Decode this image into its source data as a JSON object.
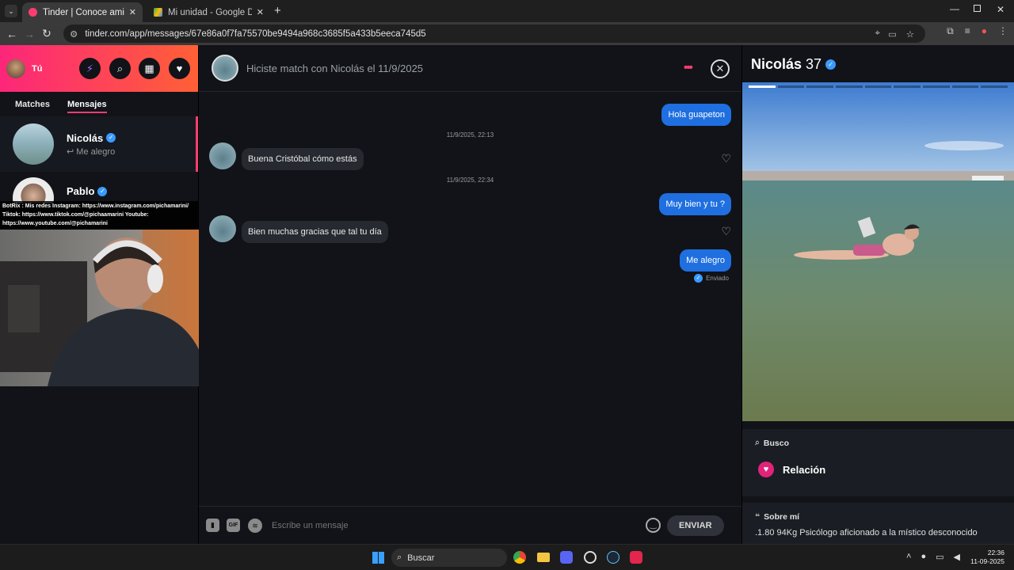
{
  "browser": {
    "tabs": [
      {
        "title": "Tinder | Conoce amigos y gent",
        "active": true,
        "fav_color": "#fe3c72"
      },
      {
        "title": "Mi unidad - Google Drive",
        "active": false,
        "fav_color": "#34a853"
      }
    ],
    "url": "tinder.com/app/messages/67e86a0f7fa75570be9494a968c3685f5a433b5eeca745d5"
  },
  "sidebar": {
    "user_label": "Tú",
    "tabs": [
      "Matches",
      "Mensajes"
    ],
    "conversations": [
      {
        "name": "Nicolás",
        "preview": "Me alegro"
      },
      {
        "name": "Pablo",
        "preview": ""
      }
    ]
  },
  "overlay": {
    "line1": "BotRix : Mis redes Instagram: https://www.instagram.com/pichamarini/",
    "line2": "Tiktok: https://www.tiktok.com/@pichaamarini Youtube:",
    "line3": "https://www.youtube.com/@pichamarini"
  },
  "chat": {
    "header_title": "Hiciste match con Nicolás el 11/9/2025",
    "messages": [
      {
        "dir": "out",
        "text": "Hola guapeton"
      },
      {
        "dir": "ts",
        "text": "11/9/2025, 22:13"
      },
      {
        "dir": "in",
        "text": "Buena Cristóbal cómo estás"
      },
      {
        "dir": "ts",
        "text": "11/9/2025, 22:34"
      },
      {
        "dir": "out",
        "text": "Muy bien y tu ?"
      },
      {
        "dir": "in",
        "text": "Bien muchas gracias que tal tu día"
      },
      {
        "dir": "out",
        "text": "Me alegro"
      }
    ],
    "status": "Enviado",
    "composer": {
      "placeholder": "Escribe un mensaje",
      "send_label": "ENVIAR",
      "gif_label": "GIF"
    }
  },
  "profile": {
    "name": "Nicolás",
    "age": "37",
    "looking_label": "Busco",
    "looking_value": "Relación",
    "about_label": "Sobre mí",
    "about_text": ".1.80 94Kg Psicólogo aficionado a la místico desconocido"
  },
  "taskbar": {
    "search_label": "Buscar",
    "time": "22:36",
    "date": "11-09-2025"
  },
  "colors": {
    "brand_start": "#fd267a",
    "brand_end": "#ff6036",
    "bubble_out": "#1f6fe0",
    "verified": "#3a9bff"
  }
}
